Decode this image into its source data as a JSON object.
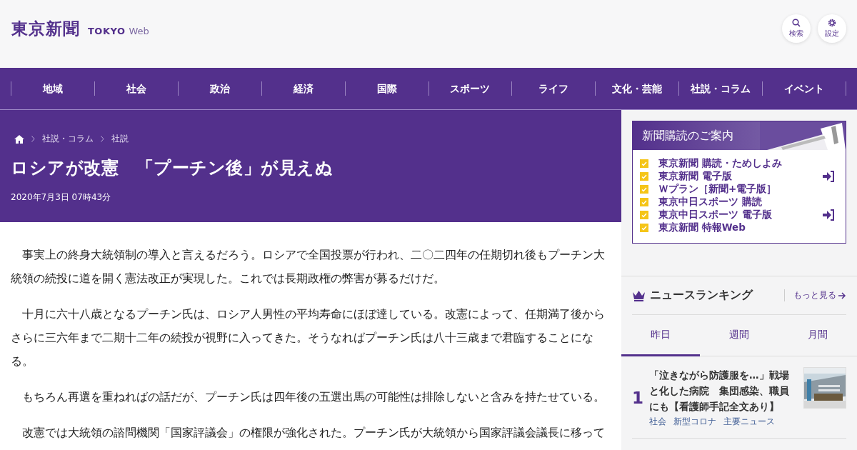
{
  "header": {
    "logo": "東京新聞",
    "logo_sub_bold": "TOKYO",
    "logo_sub_light": "Web",
    "buttons": [
      {
        "kind": "search",
        "label": "検索"
      },
      {
        "kind": "settings",
        "label": "設定"
      }
    ]
  },
  "nav": [
    "地域",
    "社会",
    "政治",
    "経済",
    "国際",
    "スポーツ",
    "ライフ",
    "文化・芸能",
    "社説・コラム",
    "イベント"
  ],
  "breadcrumb": [
    "社説・コラム",
    "社説"
  ],
  "article": {
    "title": "ロシアが改憲　「プーチン後」が見えぬ",
    "date": "2020年7月3日 07時43分",
    "paragraphs": [
      "　事実上の終身大統領制の導入と言えるだろう。ロシアで全国投票が行われ、二〇二四年の任期切れ後もプーチン大統領の続投に道を開く憲法改正が実現した。これでは長期政権の弊害が募るだけだ。",
      "　十月に六十八歳となるプーチン氏は、ロシア人男性の平均寿命にほぼ達している。改憲によって、任期満了後からさらに三六年まで二期十二年の続投が視野に入ってきた。そうなればプーチン氏は八十三歳まで君臨することになる。",
      "　もちろん再選を重ねればの話だが、プーチン氏は四年後の五選出馬の可能性は排除しないと含みを持たせている。",
      "　改憲では大統領の諮問機関「国家評議会」の権限が強化された。プーチン氏が大統領から国家評議会議長に移って"
    ]
  },
  "subscription": {
    "title": "新聞購読のご案内",
    "items": [
      {
        "label": "東京新聞 購読・ためしよみ",
        "arrow": false
      },
      {
        "label": "東京新聞 電子版",
        "arrow": true
      },
      {
        "label": "Ｗプラン［新聞+電子版］",
        "arrow": false
      },
      {
        "label": "東京中日スポーツ 購読",
        "arrow": false
      },
      {
        "label": "東京中日スポーツ 電子版",
        "arrow": true
      },
      {
        "label": "東京新聞 特報Web",
        "arrow": false
      }
    ]
  },
  "ranking": {
    "title": "ニュースランキング",
    "more": "もっと見る",
    "tabs": [
      {
        "label": "昨日",
        "selected": true
      },
      {
        "label": "週間",
        "selected": false
      },
      {
        "label": "月間",
        "selected": false
      }
    ],
    "items": [
      {
        "rank": "1",
        "title": "「泣きながら防護服を…」戦場と化した病院　集団感染、職員にも【看護師手記全文あり】",
        "tags": [
          "社会",
          "新型コロナ",
          "主要ニュース"
        ],
        "thumbnail": {
          "kind": "picture"
        }
      }
    ]
  }
}
